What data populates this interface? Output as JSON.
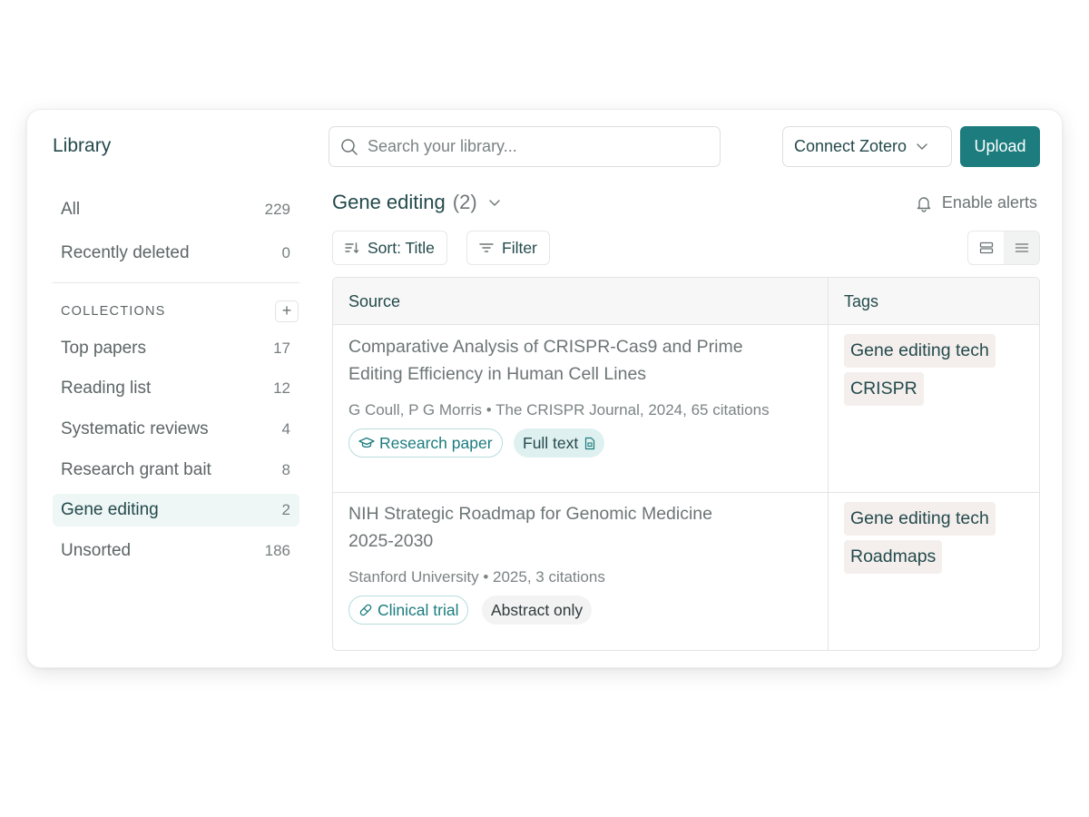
{
  "sidebar": {
    "title": "Library",
    "top_items": [
      {
        "label": "All",
        "count": "229"
      },
      {
        "label": "Recently deleted",
        "count": "0"
      }
    ],
    "collections_header": "COLLECTIONS",
    "add_label": "+",
    "collections": [
      {
        "label": "Top papers",
        "count": "17"
      },
      {
        "label": "Reading list",
        "count": "12"
      },
      {
        "label": "Systematic reviews",
        "count": "4"
      },
      {
        "label": "Research grant bait",
        "count": "8"
      },
      {
        "label": "Gene editing",
        "count": "2",
        "active": true
      },
      {
        "label": "Unsorted",
        "count": "186"
      }
    ]
  },
  "header": {
    "search_placeholder": "Search your library...",
    "connect_label": "Connect Zotero",
    "upload_label": "Upload"
  },
  "collection": {
    "name": "Gene editing",
    "count": "(2)",
    "alerts_label": "Enable alerts",
    "sort_label": "Sort: Title",
    "filter_label": "Filter"
  },
  "table": {
    "columns": [
      "Source",
      "Tags"
    ],
    "rows": [
      {
        "title_line1": "Comparative Analysis of CRISPR-Cas9 and Prime",
        "title_line2": "Editing Efficiency in Human Cell Lines",
        "meta": "G Coull, P G Morris • The CRISPR Journal, 2024, 65 citations",
        "type_label": "Research paper",
        "type_icon": "graduation-cap-icon",
        "access_label": "Full text",
        "access_icon": "document-icon",
        "tags": [
          "Gene editing tech",
          "CRISPR"
        ]
      },
      {
        "title_line1": "NIH Strategic Roadmap for Genomic Medicine",
        "title_line2": "2025-2030",
        "meta": "Stanford University • 2025, 3 citations",
        "type_label": "Clinical trial",
        "type_icon": "pill-icon",
        "access_label": "Abstract only",
        "tags": [
          "Gene editing tech",
          "Roadmaps"
        ]
      }
    ]
  },
  "colors": {
    "accent": "#1c7c7e",
    "active_bg": "#eef6f6",
    "tag_bg": "#f4efed"
  }
}
